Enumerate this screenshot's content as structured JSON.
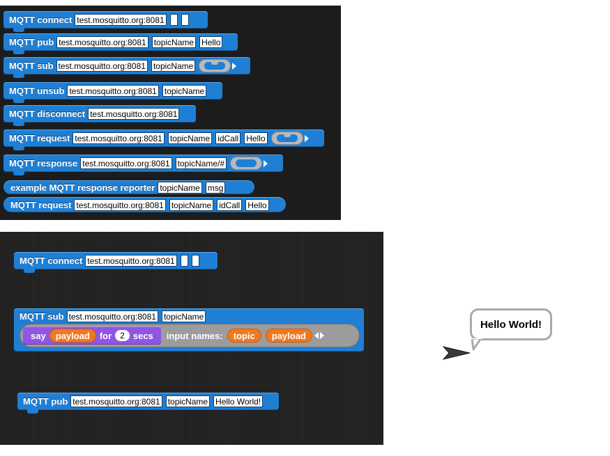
{
  "blocks_top": [
    {
      "label": "MQTT connect",
      "slots": [
        "test.mosquitto.org:8081",
        "",
        ""
      ]
    },
    {
      "label": "MQTT pub",
      "slots": [
        "test.mosquitto.org:8081",
        "topicName",
        "Hello"
      ]
    },
    {
      "label": "MQTT sub",
      "slots": [
        "test.mosquitto.org:8081",
        "topicName"
      ]
    },
    {
      "label": "MQTT unsub",
      "slots": [
        "test.mosquitto.org:8081",
        "topicName"
      ]
    },
    {
      "label": "MQTT disconnect",
      "slots": [
        "test.mosquitto.org:8081"
      ]
    },
    {
      "label": "MQTT request",
      "slots": [
        "test.mosquitto.org:8081",
        "topicName",
        "idCall",
        "Hello"
      ]
    },
    {
      "label": "MQTT response",
      "slots": [
        "test.mosquitto.org:8081",
        "topicName/#"
      ]
    },
    {
      "label": "example MQTT response reporter",
      "slots": [
        "topicName",
        "msg"
      ]
    },
    {
      "label": "MQTT request",
      "slots": [
        "test.mosquitto.org:8081",
        "topicName",
        "idCall",
        "Hello"
      ]
    }
  ],
  "script": {
    "connect": {
      "label": "MQTT connect",
      "slots": [
        "test.mosquitto.org:8081",
        "",
        ""
      ]
    },
    "sub": {
      "label": "MQTT sub",
      "slots": [
        "test.mosquitto.org:8081",
        "topicName"
      ],
      "say_label": "say",
      "say_var": "payload",
      "for_label": "for",
      "secs_value": "2",
      "secs_label": "secs",
      "input_names_label": "input names:",
      "param1": "topic",
      "param2": "payload"
    },
    "pub": {
      "label": "MQTT pub",
      "slots": [
        "test.mosquitto.org:8081",
        "topicName",
        "Hello World!"
      ]
    }
  },
  "stage": {
    "speech_bubble": "Hello World!"
  },
  "colors": {
    "motion_blue": "#1f7fd4",
    "looks_purple": "#8f56e3",
    "variable_orange": "#f1781f",
    "ring_gray": "#9c9c9c"
  }
}
